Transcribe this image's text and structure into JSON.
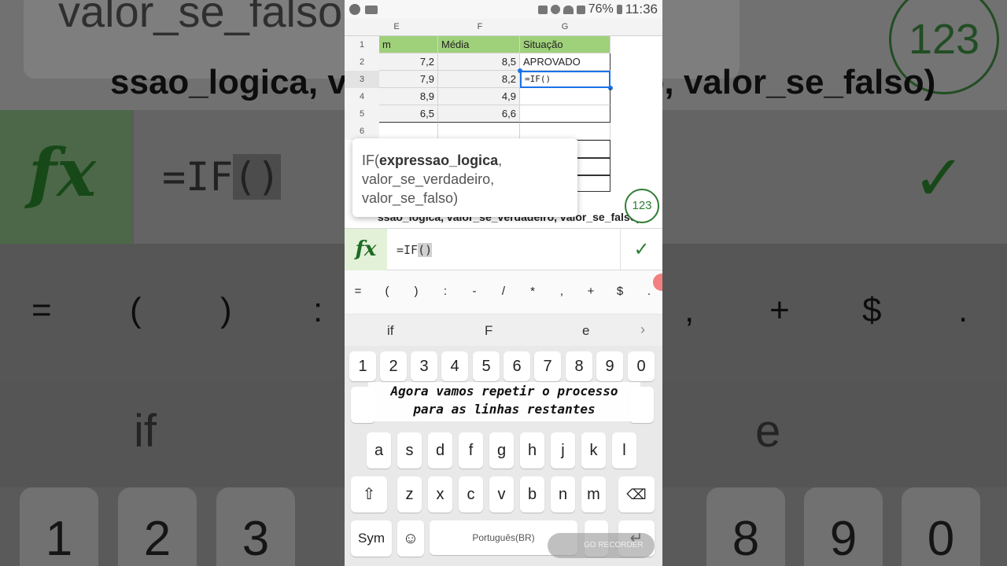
{
  "status_bar": {
    "battery": "76%",
    "time": "11:36"
  },
  "spreadsheet": {
    "columns": [
      "E",
      "F",
      "G"
    ],
    "header_row": {
      "row": "1",
      "e": "m",
      "f": "Média",
      "g": "Situação"
    },
    "rows": [
      {
        "row": "2",
        "e": "7,2",
        "f": "8,5",
        "g": "APROVADO"
      },
      {
        "row": "3",
        "e": "7,9",
        "f": "8,2",
        "g": "=IF()"
      },
      {
        "row": "4",
        "e": "8,9",
        "f": "4,9",
        "g": ""
      },
      {
        "row": "5",
        "e": "6,5",
        "f": "6,6",
        "g": ""
      },
      {
        "row": "6",
        "e": "",
        "f": "",
        "g": ""
      }
    ]
  },
  "tooltip": {
    "func_name": "IF(",
    "arg1": "expressao_logica",
    "comma": ",",
    "arg2": "valor_se_verdadeiro,",
    "arg3": "valor_se_falso)"
  },
  "tooltip_under": "ssao_logica, valor_se_verdadeiro, valor_se_falso)",
  "badge": "123",
  "formula_bar": {
    "fx": "fx",
    "prefix": "=IF",
    "highlight": "()",
    "confirm": "✓"
  },
  "symbols": [
    "=",
    "(",
    ")",
    ":",
    "-",
    "/",
    "*",
    ",",
    "+",
    "$",
    "."
  ],
  "suggestions": [
    "if",
    "F",
    "e"
  ],
  "keyboard": {
    "number_row": [
      "1",
      "2",
      "3",
      "4",
      "5",
      "6",
      "7",
      "8",
      "9",
      "0"
    ],
    "row_asdf": [
      "a",
      "s",
      "d",
      "f",
      "g",
      "h",
      "j",
      "k",
      "l"
    ],
    "row_zxcv": [
      "z",
      "x",
      "c",
      "v",
      "b",
      "n",
      "m"
    ],
    "sym_label": "Sym",
    "space_label": "Português(BR)"
  },
  "caption": {
    "line1": "Agora vamos repetir o processo",
    "line2": "para as linhas restantes"
  },
  "recorder": "GO RECORDER",
  "background": {
    "tooltip_text": "valor_se_falso",
    "formula_row_text": "ssao_logica,  valor_se_verdadeiro, valor_se_falso)",
    "formula": "=IF()",
    "keys_bottom": [
      "1",
      "2",
      "3",
      "8",
      "9",
      "0"
    ],
    "symbols": [
      "=",
      "(",
      ")",
      ":",
      ",",
      "+",
      "$",
      "."
    ],
    "suggestions": [
      "if",
      "e"
    ]
  }
}
